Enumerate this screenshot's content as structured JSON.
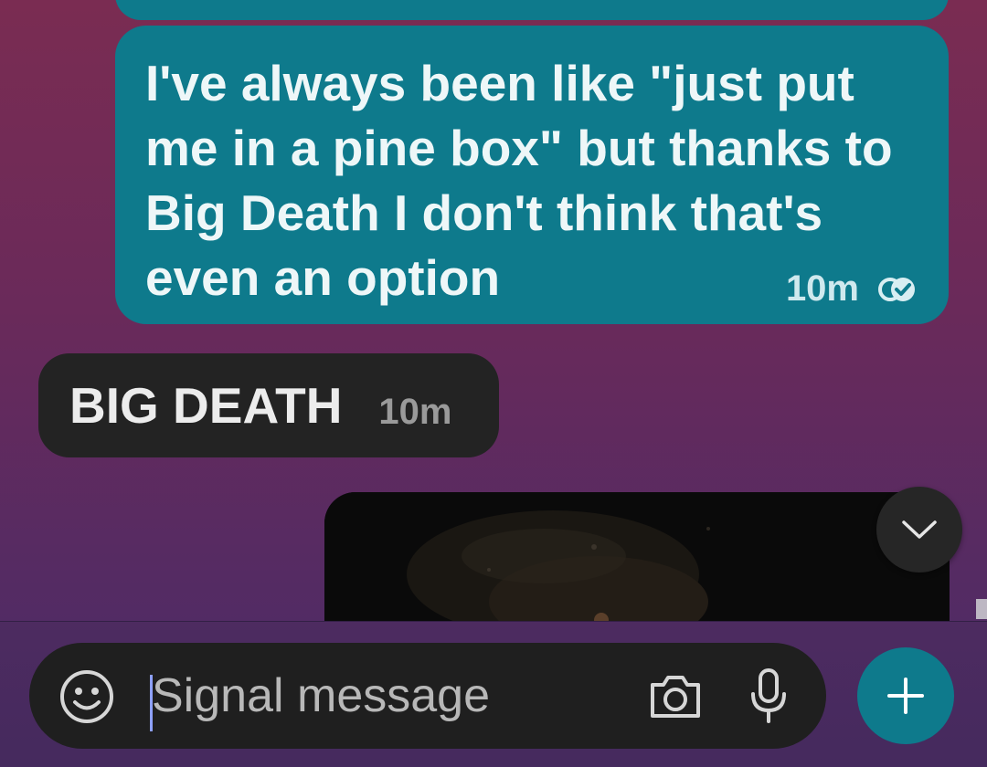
{
  "messages": {
    "outgoing": {
      "text": "I've always been like \"just put me in a pine box\" but thanks to Big Death I don't think that's even an option",
      "time": "10m",
      "status_icon": "read-receipt-icon"
    },
    "incoming": {
      "text": "BIG DEATH",
      "time": "10m"
    },
    "image_message": {
      "icon": "image-attachment"
    }
  },
  "scroll_button": {
    "icon": "chevron-down-icon"
  },
  "composer": {
    "placeholder": "Signal message",
    "value": "",
    "emoji_icon": "emoji-icon",
    "camera_icon": "camera-icon",
    "mic_icon": "microphone-icon",
    "attach_icon": "plus-icon"
  },
  "colors": {
    "outgoing_bubble": "#0e7a8c",
    "incoming_bubble": "#232323",
    "composer_bg": "#1f1f1f",
    "accent": "#0e7a8c"
  }
}
